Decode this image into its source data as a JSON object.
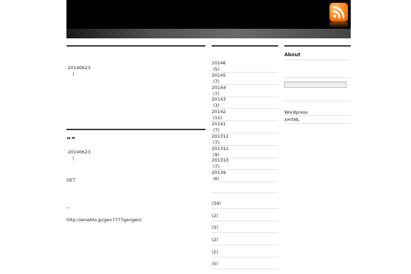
{
  "header": {
    "rss_icon": "rss-icon",
    "accent": "#ff8a1c",
    "bg": "#000000"
  },
  "posts": [
    {
      "date": "20140623",
      "sep": "|"
    },
    {
      "title": "“”",
      "date": "20140623",
      "sep": "|",
      "lines": [
        "GET",
        "--",
        "http://ameblo.jp/gen7777gengen/"
      ]
    }
  ],
  "archives": [
    {
      "month": "20146",
      "count": "(5)"
    },
    {
      "month": "20145",
      "count": "(7)"
    },
    {
      "month": "20144",
      "count": "(7)"
    },
    {
      "month": "20143",
      "count": "(3)"
    },
    {
      "month": "20142",
      "count": "(11)"
    },
    {
      "month": "20141",
      "count": "(7)"
    },
    {
      "month": "201312",
      "count": "(7)"
    },
    {
      "month": "201311",
      "count": "(9)"
    },
    {
      "month": "201310",
      "count": "(7)"
    },
    {
      "month": "20139",
      "count": "(6)"
    }
  ],
  "categories": [
    "(34)",
    "(2)",
    "(3)",
    "(2)",
    "(2)",
    "(5)"
  ],
  "sidebar": {
    "about_title": "About",
    "links": [
      "Wordpress",
      "XHTML"
    ]
  }
}
